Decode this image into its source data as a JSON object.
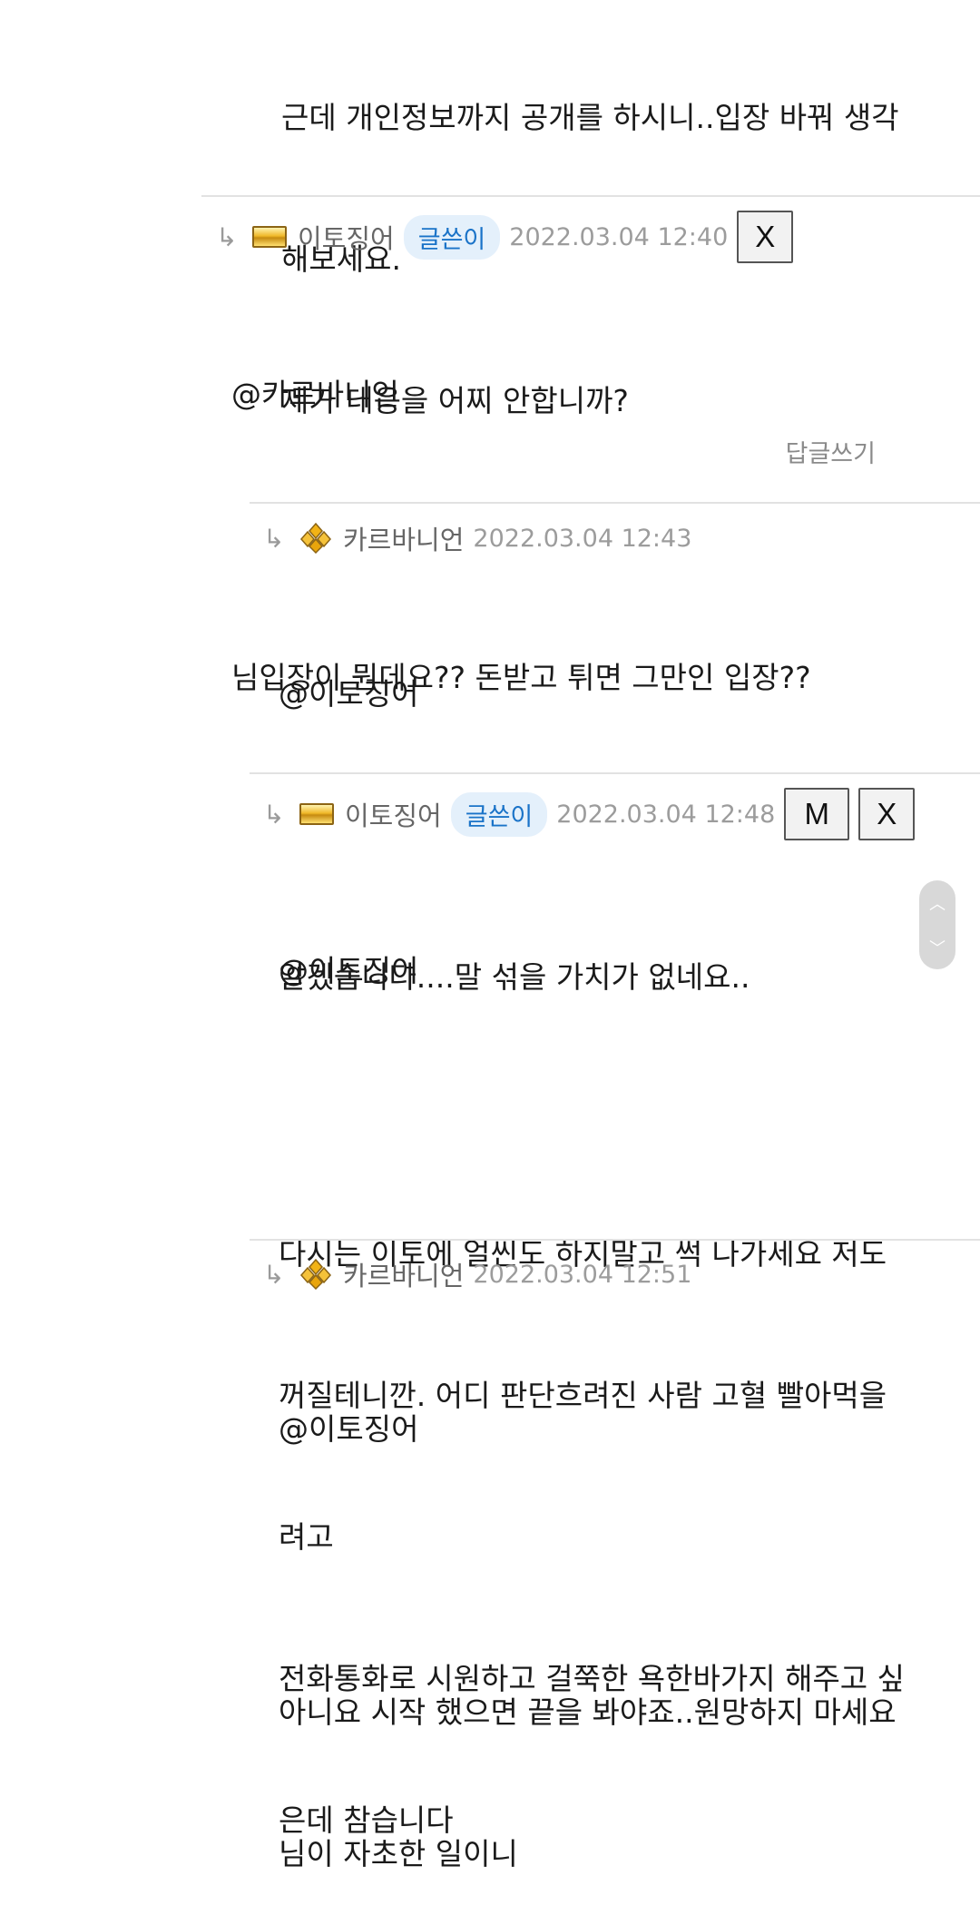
{
  "top_comment": {
    "lines": [
      "근데 개인정보까지 공개를 하시니..입장 바꿔 생각",
      "해보세요.",
      "제가 대응을 어찌 안합니까?"
    ]
  },
  "comments": [
    {
      "author": "이토징어",
      "badge": "글쓴이",
      "date": "2022.03.04 12:40",
      "buttons": [
        "X"
      ],
      "lines": [
        "@카르바니언",
        "",
        "님입장이 뭔데요?? 돈받고 튀면 그만인 입장??"
      ],
      "reply_label": "답글쓰기"
    },
    {
      "author": "카르바니언",
      "date": "2022.03.04 12:43",
      "lines": [
        "@이토징어",
        "",
        "알겠습니다....말 섞을 가치가 없네요.."
      ]
    },
    {
      "author": "이토징어",
      "badge": "글쓴이",
      "date": "2022.03.04 12:48",
      "buttons": [
        "M",
        "X"
      ],
      "lines": [
        "@이토징어",
        "",
        "다시는 이토에 얼씬도 하지말고 썩 나가세요 저도",
        "꺼질테니깐. 어디 판단흐려진 사람 고혈 빨아먹을",
        "려고",
        "전화통화로 시원하고 걸쭉한 욕한바가지 해주고 싶",
        "은데 참습니다"
      ]
    },
    {
      "author": "카르바니언",
      "date": "2022.03.04 12:51",
      "lines": [
        "@이토징어",
        "",
        "아니요 시작 했으면 끝을 봐야죠..원망하지 마세요",
        "님이 자초한 일이니"
      ]
    }
  ],
  "icons": {
    "reply_arrow": "reply-arrow-icon",
    "rank_bar": "gold-bar-rank-icon",
    "rank_gem": "gold-gem-rank-icon",
    "scroll": [
      "chevron-up-icon",
      "chevron-down-icon"
    ]
  },
  "colors": {
    "badge_text": "#1a73c8",
    "badge_bg": "#e4f0fb",
    "meta_text": "#9c9c9c",
    "divider": "#e2e2e2"
  }
}
